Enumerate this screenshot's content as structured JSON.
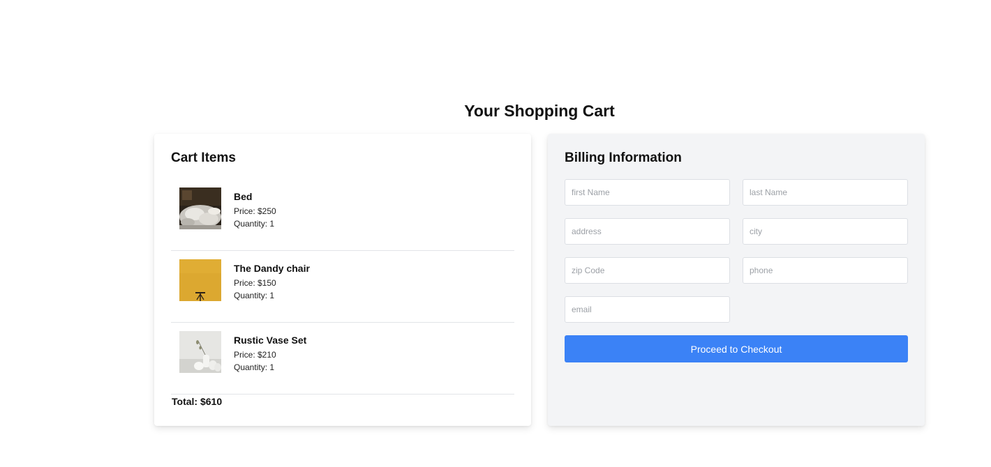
{
  "page": {
    "title": "Your Shopping Cart"
  },
  "cart": {
    "heading": "Cart Items",
    "items": [
      {
        "name": "Bed",
        "price": "Price: $250",
        "quantity": "Quantity: 1",
        "image": "bed-photo"
      },
      {
        "name": "The Dandy chair",
        "price": "Price: $150",
        "quantity": "Quantity: 1",
        "image": "chair-photo"
      },
      {
        "name": "Rustic Vase Set",
        "price": "Price: $210",
        "quantity": "Quantity: 1",
        "image": "vase-photo"
      }
    ],
    "total": "Total: $610"
  },
  "billing": {
    "heading": "Billing Information",
    "fields": {
      "first_name": "first Name",
      "last_name": "last Name",
      "address": "address",
      "city": "city",
      "zip": "zip Code",
      "phone": "phone",
      "email": "email"
    },
    "checkout_label": "Proceed to Checkout"
  },
  "colors": {
    "accent": "#3b82f6",
    "billing_background": "#f3f4f6"
  }
}
